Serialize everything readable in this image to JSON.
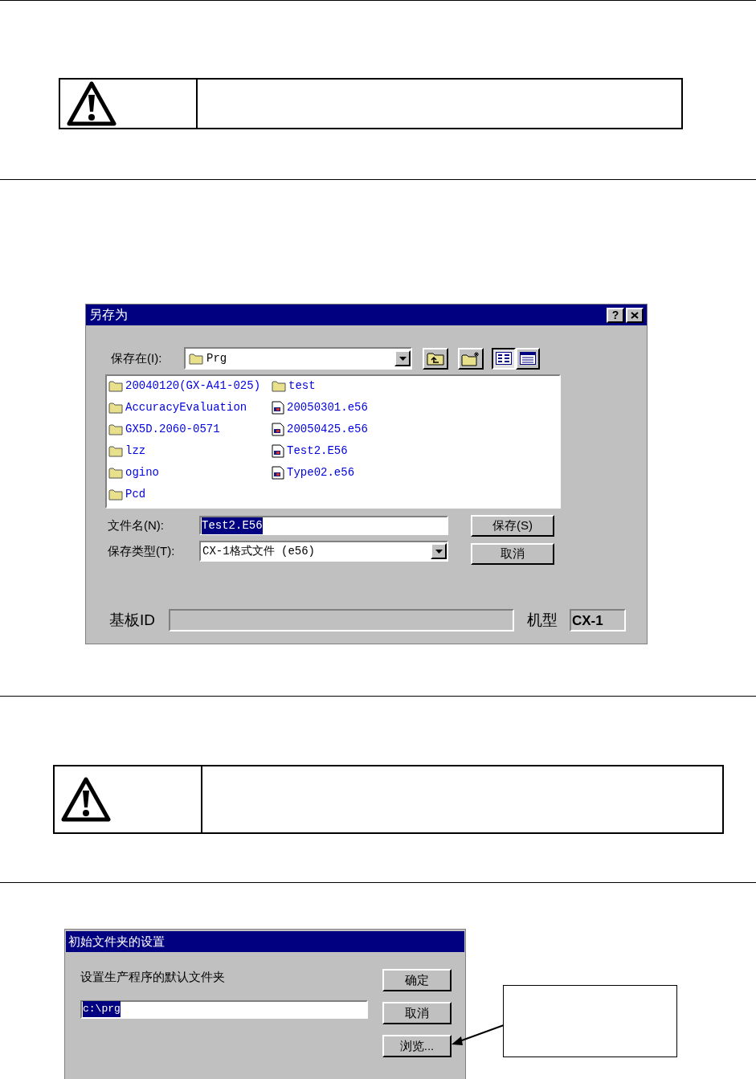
{
  "save_dialog": {
    "title": "另存为",
    "help_button": "?",
    "save_in_label": "保存在(I):",
    "save_in_value": "Prg",
    "view_modes": [
      {
        "selected": true
      },
      {
        "selected": false
      }
    ],
    "files": [
      {
        "name": "20040120(GX-A41-025)",
        "kind": "folder"
      },
      {
        "name": "AccuracyEvaluation",
        "kind": "folder"
      },
      {
        "name": "GX5D.2060-0571",
        "kind": "folder"
      },
      {
        "name": "lzz",
        "kind": "folder"
      },
      {
        "name": "ogino",
        "kind": "folder"
      },
      {
        "name": "Pcd",
        "kind": "folder"
      },
      {
        "name": "test",
        "kind": "folder"
      },
      {
        "name": "20050301.e56",
        "kind": "file"
      },
      {
        "name": "20050425.e56",
        "kind": "file"
      },
      {
        "name": "Test2.E56",
        "kind": "file"
      },
      {
        "name": "Type02.e56",
        "kind": "file"
      }
    ],
    "file_name_label": "文件名(N):",
    "file_name_value": "Test2.E56",
    "file_name_selected": true,
    "file_type_label": "保存类型(T):",
    "file_type_value": "CX-1格式文件 (e56)",
    "buttons": [
      "保存(S)",
      "取消"
    ],
    "board_id_label": "基板ID",
    "model_label": "机型",
    "model_value": "CX-1"
  },
  "folder_dialog": {
    "title": "初始文件夹的设置",
    "prompt": "设置生产程序的默认文件夹",
    "path_value": "c:\\prg",
    "path_selected": true,
    "buttons": [
      "确定",
      "取消",
      "浏览..."
    ]
  }
}
